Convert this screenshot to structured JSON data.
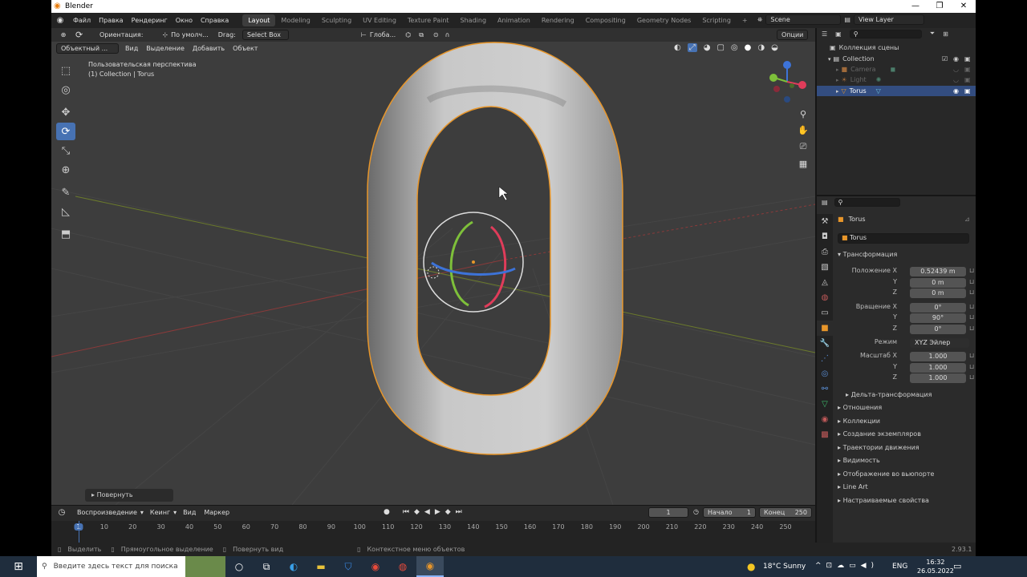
{
  "window": {
    "title": "Blender",
    "min": "—",
    "max": "❐",
    "close": "✕"
  },
  "topmenu": {
    "items": [
      "Файл",
      "Правка",
      "Рендеринг",
      "Окно",
      "Справка"
    ],
    "workspaces": [
      "Layout",
      "Modeling",
      "Sculpting",
      "UV Editing",
      "Texture Paint",
      "Shading",
      "Animation",
      "Rendering",
      "Compositing",
      "Geometry Nodes",
      "Scripting"
    ],
    "active_workspace": "Layout",
    "add_tab": "+",
    "scene": "Scene",
    "view_layer": "View Layer"
  },
  "viewport": {
    "orientation_label": "Ориентация:",
    "orientation_value": "По умолч...",
    "drag_label": "Drag:",
    "drag_value": "Select Box",
    "transform_orientation": "Глоба...",
    "options": "Опции",
    "mode": "Объектный ...",
    "menus": [
      "Вид",
      "Выделение",
      "Добавить",
      "Объект"
    ],
    "info_line1": "Пользовательская перспектива",
    "info_line2": "(1) Collection | Torus",
    "last_operator": "Повернуть"
  },
  "outliner": {
    "root": "Коллекция сцены",
    "rows": [
      {
        "name": "Collection",
        "icon": "collection-icon"
      },
      {
        "name": "Camera",
        "icon": "camera-icon"
      },
      {
        "name": "Light",
        "icon": "light-icon"
      },
      {
        "name": "Torus",
        "icon": "mesh-icon",
        "selected": true
      }
    ]
  },
  "properties": {
    "object_name": "Torus",
    "data_name": "Torus",
    "transform_header": "Трансформация",
    "location": {
      "label": "Положение X",
      "x": "0.52439 m",
      "y": "0 m",
      "z": "0 m"
    },
    "rotation": {
      "label": "Вращение X",
      "x": "0°",
      "y": "90°",
      "z": "0°"
    },
    "mode": {
      "label": "Режим",
      "value": "XYZ Эйлер"
    },
    "scale": {
      "label": "Масштаб X",
      "x": "1.000",
      "y": "1.000",
      "z": "1.000"
    },
    "axis_y": "Y",
    "axis_z": "Z",
    "delta": "Дельта-трансформация",
    "sections": [
      "Отношения",
      "Коллекции",
      "Создание экземпляров",
      "Траектории движения",
      "Видимость",
      "Отображение во вьюпорте",
      "Line Art",
      "Настраиваемые свойства"
    ]
  },
  "timeline": {
    "playback": "Воспроизведение",
    "keying": "Кеинг",
    "view": "Вид",
    "marker": "Маркер",
    "current_frame": "1",
    "start_label": "Начало",
    "start": "1",
    "end_label": "Конец",
    "end": "250",
    "ticks": [
      "1",
      "10",
      "20",
      "30",
      "40",
      "50",
      "60",
      "70",
      "80",
      "90",
      "100",
      "110",
      "120",
      "130",
      "140",
      "150",
      "160",
      "170",
      "180",
      "190",
      "200",
      "210",
      "220",
      "230",
      "240",
      "250"
    ]
  },
  "status": {
    "select": "Выделить",
    "box_select": "Прямоугольное выделение",
    "rotate_view": "Повернуть вид",
    "context_menu": "Контекстное меню объектов",
    "version": "2.93.1"
  },
  "taskbar": {
    "search_placeholder": "Введите здесь текст для поиска",
    "weather": "18°C  Sunny",
    "lang": "ENG",
    "time": "16:32",
    "date": "26.05.2022"
  },
  "colors": {
    "accent": "#4772b3",
    "selection": "#e8962a",
    "outliner_selected": "#334d80"
  }
}
